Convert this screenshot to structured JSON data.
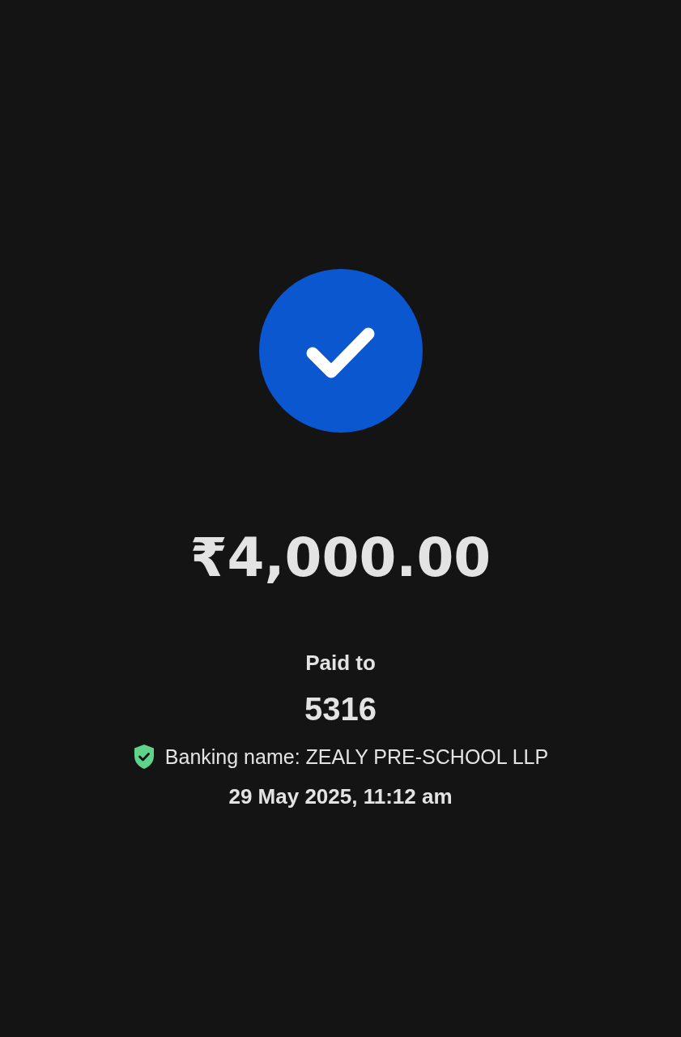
{
  "status": {
    "success": true
  },
  "amount": "₹4,000.00",
  "paid_to_label": "Paid to",
  "payee": "5316",
  "banking_name": {
    "text": "Banking name: ZEALY PRE-SCHOOL LLP",
    "verified": true
  },
  "timestamp": "29 May 2025, 11:12 am"
}
